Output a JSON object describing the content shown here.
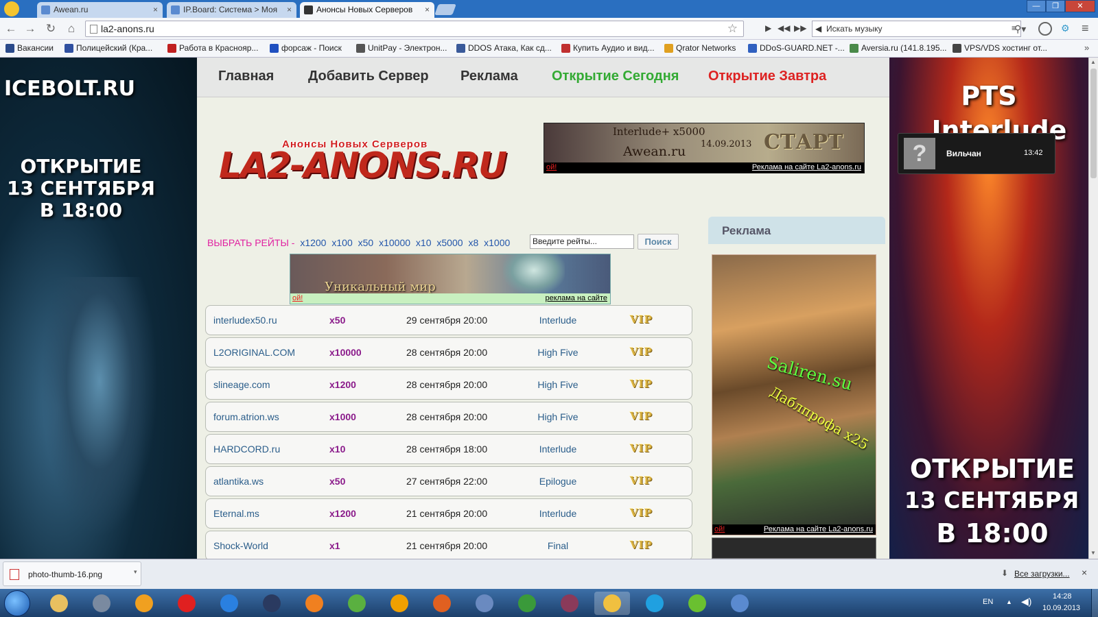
{
  "browser": {
    "tabs": [
      {
        "label": "Awean.ru",
        "close": "×"
      },
      {
        "label": "IP.Board: Система > Моя",
        "close": "×"
      },
      {
        "label": "Анонсы Новых Серверов",
        "close": "×"
      }
    ],
    "window_controls": [
      "—",
      "❐",
      "✕"
    ],
    "address": "la2-anons.ru",
    "music_placeholder": "Искать музыку",
    "bookmarks": [
      {
        "label": "Вакансии",
        "color": "#2a4a8a"
      },
      {
        "label": "Полицейский (Кра...",
        "color": "#3050a0"
      },
      {
        "label": "Работа в Краснояр...",
        "color": "#c02020"
      },
      {
        "label": "форсаж - Поиск",
        "color": "#2050c0"
      },
      {
        "label": "UnitPay - Электрон...",
        "color": "#555555"
      },
      {
        "label": "DDOS Атака, Как сд...",
        "color": "#3a5a9a"
      },
      {
        "label": "Купить Аудио и вид...",
        "color": "#c03030"
      },
      {
        "label": "Qrator Networks",
        "color": "#e0a020"
      },
      {
        "label": "DDoS-GUARD.NET -...",
        "color": "#3060c0"
      },
      {
        "label": "Aversia.ru (141.8.195...",
        "color": "#4a8a4a"
      },
      {
        "label": "VPS/VDS хостинг от...",
        "color": "#444444"
      }
    ]
  },
  "left_banner": {
    "site": "ICEBOLT.RU",
    "line1": "ОТКРЫТИЕ",
    "line2": "13 СЕНТЯБРЯ",
    "line3": "В 18:00"
  },
  "right_banner": {
    "line1": "PTS",
    "line2": "Interlude",
    "line3": "ОТКРЫТИЕ",
    "line4": "13 СЕНТЯБРЯ",
    "line5": "В 18:00"
  },
  "nav": [
    {
      "label": "Главная",
      "color": "#333333"
    },
    {
      "label": "Добавить Сервер",
      "color": "#333333"
    },
    {
      "label": "Реклама",
      "color": "#333333"
    },
    {
      "label": "Открытие Сегодня",
      "color": "#33aa33"
    },
    {
      "label": "Открытие Завтра",
      "color": "#dd2222"
    }
  ],
  "logo": {
    "text": "LA2-ANONS.RU",
    "tagline": "Анонсы Новых Серверов"
  },
  "top_ad": {
    "line1": "Interlude+ x5000",
    "site": "Awean.ru",
    "date": "14.09.2013",
    "start": "СТАРТ",
    "oops": "ой!",
    "caption": "Реклама на сайте La2-anons.ru"
  },
  "rates": {
    "label": "ВЫБРАТЬ РЕЙТЫ -",
    "items": [
      "x1200",
      "x100",
      "x50",
      "x10000",
      "x10",
      "x5000",
      "x8",
      "x1000"
    ]
  },
  "search": {
    "placeholder": "Введите рейты...",
    "button": "Поиск"
  },
  "mid_ad": {
    "text": "Уникальный мир",
    "oops": "ой!",
    "caption": "реклама на сайте"
  },
  "servers": [
    {
      "site": "interludex50.ru",
      "rate": "x50",
      "date": "29 сентября 20:00",
      "chronicle": "Interlude",
      "badge": "VIP"
    },
    {
      "site": "L2ORIGINAL.COM",
      "rate": "x10000",
      "date": "28 сентября 20:00",
      "chronicle": "High Five",
      "badge": "VIP"
    },
    {
      "site": "slineage.com",
      "rate": "x1200",
      "date": "28 сентября 20:00",
      "chronicle": "High Five",
      "badge": "VIP"
    },
    {
      "site": "forum.atrion.ws",
      "rate": "x1000",
      "date": "28 сентября 20:00",
      "chronicle": "High Five",
      "badge": "VIP"
    },
    {
      "site": "HARDCORD.ru",
      "rate": "x10",
      "date": "28 сентября 18:00",
      "chronicle": "Interlude",
      "badge": "VIP"
    },
    {
      "site": "atlantika.ws",
      "rate": "x50",
      "date": "27 сентября 22:00",
      "chronicle": "Epilogue",
      "badge": "VIP"
    },
    {
      "site": "Eternal.ms",
      "rate": "x1200",
      "date": "21 сентября 20:00",
      "chronicle": "Interlude",
      "badge": "VIP"
    },
    {
      "site": "Shock-World",
      "rate": "x1",
      "date": "21 сентября 20:00",
      "chronicle": "Final",
      "badge": "VIP"
    }
  ],
  "sidebar": {
    "title": "Реклама",
    "ad_site": "Saliren.su",
    "ad_text": "Даблпрофа x25",
    "oops": "ой!",
    "caption": "Реклама на сайте La2-anons.ru"
  },
  "notification": {
    "name": "Вильчан",
    "time": "13:42"
  },
  "download": {
    "file": "photo-thumb-16.png",
    "all": "Все загрузки...",
    "close": "×"
  },
  "taskbar": {
    "lang": "EN",
    "time": "14:28",
    "date": "10.09.2013",
    "apps": [
      "explorer",
      "volume",
      "browser",
      "yandex",
      "ie",
      "globe",
      "odnoklassniki",
      "browser2",
      "mail-agent",
      "media-player",
      "mail",
      "chat",
      "winrar",
      "chrome",
      "skype",
      "icq",
      "paint"
    ]
  }
}
